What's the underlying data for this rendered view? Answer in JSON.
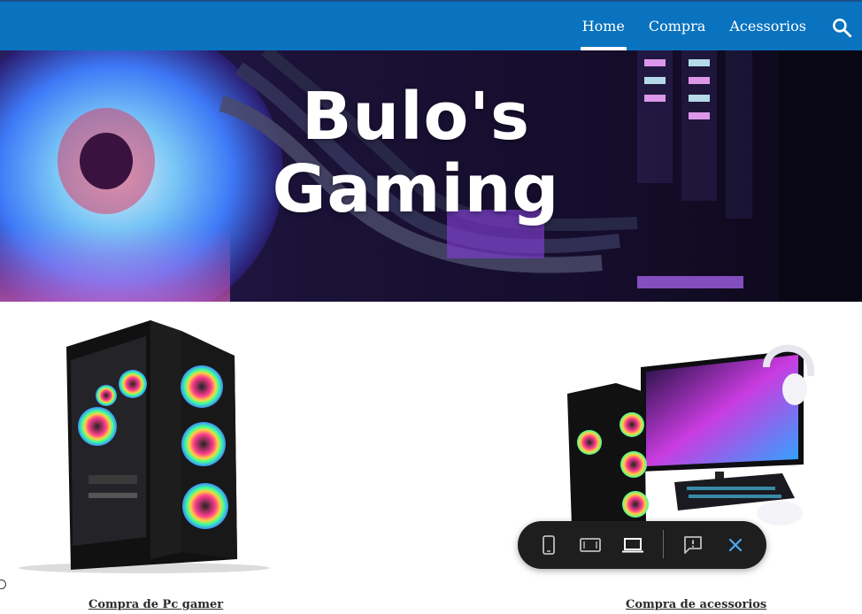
{
  "nav": {
    "items": [
      {
        "label": "Home",
        "active": true
      },
      {
        "label": "Compra",
        "active": false
      },
      {
        "label": "Acessorios",
        "active": false
      }
    ],
    "search_icon": "search-icon"
  },
  "hero": {
    "title_line1": "Bulo's",
    "title_line2": "Gaming"
  },
  "products": [
    {
      "label": "Compra de Pc gamer",
      "image": "gaming-pc-case-image"
    },
    {
      "label": "Compra de acessorios",
      "image": "gaming-setup-image"
    }
  ],
  "preview_toolbar": {
    "buttons": [
      "phone-preview-icon",
      "tablet-preview-icon",
      "laptop-preview-icon",
      "report-feedback-icon",
      "close-icon"
    ],
    "active": "laptop-preview-icon"
  },
  "colors": {
    "nav_bg": "#0a73bf",
    "toolbar_bg": "#1e1e1e",
    "toolbar_accent": "#4aa9f0"
  }
}
